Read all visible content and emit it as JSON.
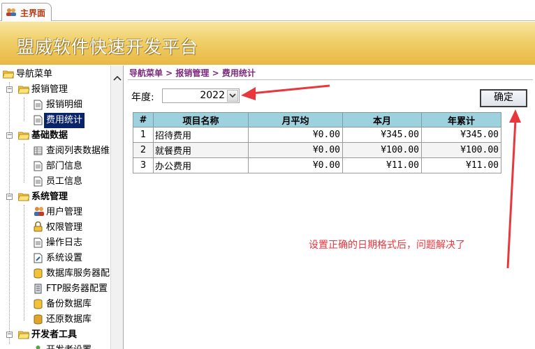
{
  "tab": {
    "label": "主界面"
  },
  "banner": {
    "title": "盟威软件快速开发平台"
  },
  "nav": {
    "root": "导航菜单",
    "groups": [
      {
        "label": "报销管理",
        "items": [
          "报销明细",
          "费用统计"
        ]
      },
      {
        "label": "基础数据",
        "items": [
          "查阅列表数据维",
          "部门信息",
          "员工信息"
        ]
      },
      {
        "label": "系统管理",
        "items": [
          "用户管理",
          "权限管理",
          "操作日志",
          "系统设置",
          "数据库服务器配",
          "FTP服务器配置",
          "备份数据库",
          "还原数据库"
        ]
      },
      {
        "label": "开发者工具",
        "items": [
          "开发者设置"
        ]
      }
    ],
    "selected": "费用统计"
  },
  "breadcrumb": "导航菜单 > 报销管理 > 费用统计",
  "filter": {
    "year_label": "年度:",
    "year_value": "2022"
  },
  "confirm_label": "确定",
  "table": {
    "headers": [
      "#",
      "项目名称",
      "月平均",
      "本月",
      "年累计"
    ],
    "rows": [
      [
        "1",
        "招待费用",
        "¥0.00",
        "¥345.00",
        "¥345.00"
      ],
      [
        "2",
        "就餐费用",
        "¥0.00",
        "¥100.00",
        "¥100.00"
      ],
      [
        "3",
        "办公费用",
        "¥0.00",
        "¥11.00",
        "¥11.00"
      ]
    ]
  },
  "annotation": "设置正确的日期格式后，问题解决了",
  "colors": {
    "accent_red": "#e8383e",
    "header_blue": "#9dd1de",
    "crumb_purple": "#7c2a7c",
    "banner_gold": "#f0cf69"
  }
}
